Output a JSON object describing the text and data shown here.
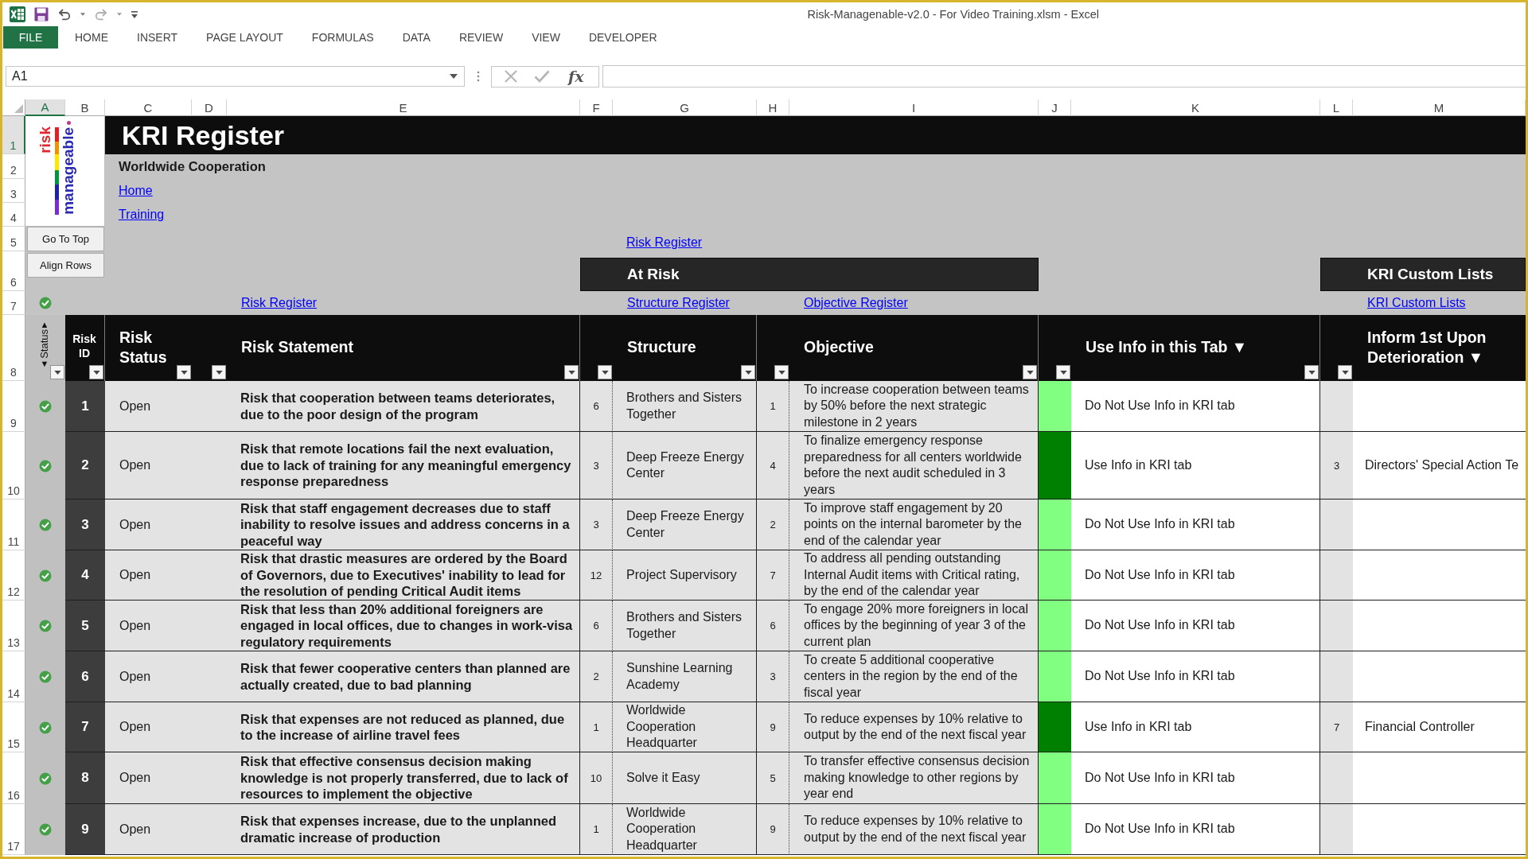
{
  "window": {
    "title": "Risk-Managenable-v2.0 - For Video Training.xlsm - Excel"
  },
  "ribbon_tabs": [
    {
      "label": "FILE",
      "kind": "file"
    },
    {
      "label": "HOME",
      "kind": "tab"
    },
    {
      "label": "INSERT",
      "kind": "tab"
    },
    {
      "label": "PAGE LAYOUT",
      "kind": "tab"
    },
    {
      "label": "FORMULAS",
      "kind": "tab"
    },
    {
      "label": "DATA",
      "kind": "tab"
    },
    {
      "label": "REVIEW",
      "kind": "tab"
    },
    {
      "label": "VIEW",
      "kind": "tab"
    },
    {
      "label": "DEVELOPER",
      "kind": "tab"
    }
  ],
  "formula_bar": {
    "name_box": "A1",
    "function_button": "fx"
  },
  "column_headers": [
    {
      "label": "A",
      "selected": true
    },
    {
      "label": "B",
      "selected": false
    },
    {
      "label": "C",
      "selected": false
    },
    {
      "label": "D",
      "selected": false
    },
    {
      "label": "E",
      "selected": false
    },
    {
      "label": "F",
      "selected": false
    },
    {
      "label": "G",
      "selected": false
    },
    {
      "label": "H",
      "selected": false
    },
    {
      "label": "I",
      "selected": false
    },
    {
      "label": "J",
      "selected": false
    },
    {
      "label": "K",
      "selected": false
    },
    {
      "label": "L",
      "selected": false
    },
    {
      "label": "M",
      "selected": false
    }
  ],
  "row_headers": [
    {
      "label": "1",
      "selected": true
    },
    {
      "label": "2",
      "selected": false
    },
    {
      "label": "3",
      "selected": false
    },
    {
      "label": "4",
      "selected": false
    },
    {
      "label": "5",
      "selected": false
    },
    {
      "label": "6",
      "selected": false
    },
    {
      "label": "7",
      "selected": false
    },
    {
      "label": "8",
      "selected": false
    },
    {
      "label": "9",
      "selected": false
    },
    {
      "label": "10",
      "selected": false
    },
    {
      "label": "11",
      "selected": false
    },
    {
      "label": "12",
      "selected": false
    },
    {
      "label": "13",
      "selected": false
    },
    {
      "label": "14",
      "selected": false
    },
    {
      "label": "15",
      "selected": false
    },
    {
      "label": "16",
      "selected": false
    },
    {
      "label": "17",
      "selected": false
    }
  ],
  "logo": {
    "word_1": "risk",
    "word_2": "manageable"
  },
  "sheet_buttons": [
    "Go To Top",
    "Align Rows"
  ],
  "register": {
    "title": "KRI Register",
    "subtitle": "Worldwide Cooperation",
    "nav_links": [
      "Home",
      "Training"
    ],
    "top_link": "Risk Register",
    "bands": [
      "At Risk",
      "KRI Custom Lists"
    ],
    "section_links": [
      "Risk Register",
      "Structure Register",
      "Objective Register",
      "KRI Custom Lists"
    ],
    "summary_checked": true
  },
  "table": {
    "status_header": {
      "up_arrow": "▲",
      "label": "Status",
      "down_arrow": "▼"
    },
    "columns": [
      "Risk ID",
      "Risk Status",
      "Risk Statement",
      "Structure",
      "Objective",
      "Use Info in this Tab ▼",
      "Inform 1st Upon Deterioration ▼"
    ],
    "rows": [
      {
        "checked": true,
        "id": "1",
        "risk_status": "Open",
        "statement": "Risk that cooperation between teams deteriorates, due to the poor design of the program",
        "structure_no": "6",
        "structure": "Brothers and Sisters Together",
        "objective_no": "1",
        "objective": "To increase cooperation between teams by 50% before the next strategic milestone in 2 years",
        "color": "#80ff80",
        "use_info": "Do Not Use Info in KRI tab"
      },
      {
        "checked": true,
        "id": "2",
        "risk_status": "Open",
        "statement": "Risk that remote locations fail the next evaluation, due to lack of training for any meaningful emergency response preparedness",
        "structure_no": "3",
        "structure": "Deep Freeze Energy Center",
        "objective_no": "4",
        "objective": "To finalize emergency response preparedness for all centers worldwide before the next audit scheduled in 3 years",
        "color": "#008000",
        "use_info": "Use Info in KRI tab",
        "inform_no": "3",
        "inform": "Directors' Special Action Te"
      },
      {
        "checked": true,
        "id": "3",
        "risk_status": "Open",
        "statement": "Risk that staff engagement decreases due to staff inability to resolve issues and address concerns in a peaceful way",
        "structure_no": "3",
        "structure": "Deep Freeze Energy Center",
        "objective_no": "2",
        "objective": "To improve staff engagement by 20 points on the internal barometer by the end of the calendar year",
        "color": "#80ff80",
        "use_info": "Do Not Use Info in KRI tab"
      },
      {
        "checked": true,
        "id": "4",
        "risk_status": "Open",
        "statement": "Risk that drastic measures are ordered by the Board of Governors, due to Executives' inability to lead for the resolution of pending Critical Audit items",
        "structure_no": "12",
        "structure": "Project Supervisory",
        "objective_no": "7",
        "objective": "To address all pending outstanding Internal Audit items with Critical rating, by the end of the calendar year",
        "color": "#80ff80",
        "use_info": "Do Not Use Info in KRI tab"
      },
      {
        "checked": true,
        "id": "5",
        "risk_status": "Open",
        "statement": "Risk that less than 20% additional foreigners are engaged in local offices, due to changes in work-visa regulatory requirements",
        "structure_no": "6",
        "structure": "Brothers and Sisters Together",
        "objective_no": "6",
        "objective": "To engage 20% more foreigners in local offices by the beginning of year 3 of the current plan",
        "color": "#80ff80",
        "use_info": "Do Not Use Info in KRI tab"
      },
      {
        "checked": true,
        "id": "6",
        "risk_status": "Open",
        "statement": "Risk that fewer cooperative centers than planned are actually created, due to bad planning",
        "structure_no": "2",
        "structure": "Sunshine Learning Academy",
        "objective_no": "3",
        "objective": "To create 5 additional cooperative centers in the region by the end of the fiscal year",
        "color": "#80ff80",
        "use_info": "Do Not Use Info in KRI tab"
      },
      {
        "checked": true,
        "id": "7",
        "risk_status": "Open",
        "statement": "Risk that expenses are not reduced as planned, due to the increase of airline travel fees",
        "structure_no": "1",
        "structure": "Worldwide Cooperation Headquarter",
        "objective_no": "9",
        "objective": "To reduce expenses by 10% relative to output by the end of the next fiscal year",
        "color": "#008000",
        "use_info": "Use Info in KRI tab",
        "inform_no": "7",
        "inform": "Financial Controller"
      },
      {
        "checked": true,
        "id": "8",
        "risk_status": "Open",
        "statement": "Risk that effective consensus decision making knowledge is not properly transferred, due to lack of resources to implement the objective",
        "structure_no": "10",
        "structure": "Solve it Easy",
        "objective_no": "5",
        "objective": "To transfer effective consensus decision making knowledge to other regions by year end",
        "color": "#80ff80",
        "use_info": "Do Not Use Info in KRI tab"
      },
      {
        "checked": true,
        "id": "9",
        "risk_status": "Open",
        "statement": "Risk that expenses increase, due to the unplanned dramatic increase of production",
        "structure_no": "1",
        "structure": "Worldwide Cooperation Headquarter",
        "objective_no": "9",
        "objective": "To reduce expenses by 10% relative to output by the end of the next fiscal year",
        "color": "#80ff80",
        "use_info": "Do Not Use Info in KRI tab"
      }
    ]
  }
}
